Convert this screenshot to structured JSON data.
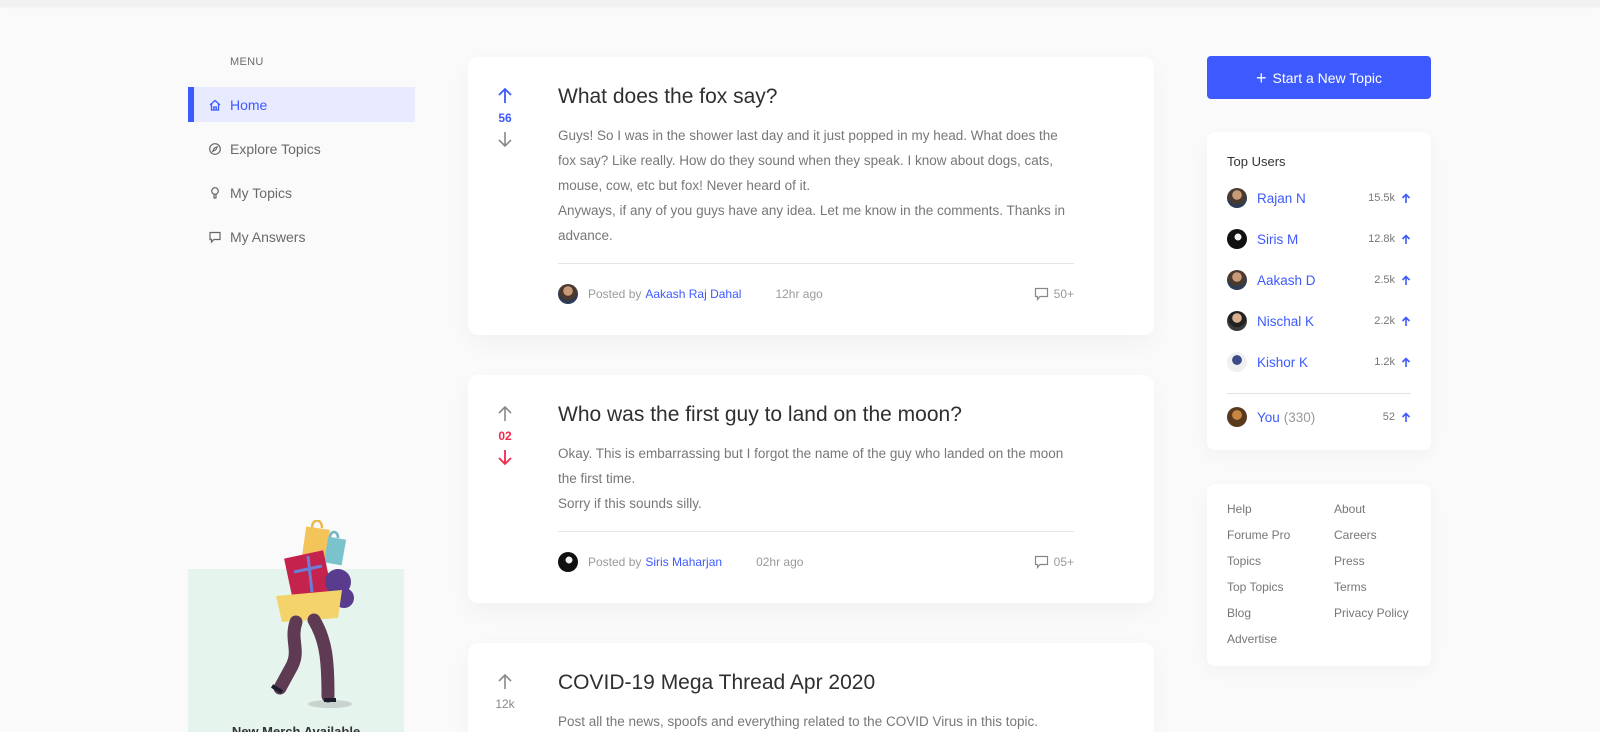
{
  "menu": {
    "title": "MENU",
    "items": [
      {
        "label": "Home",
        "icon": "home-icon",
        "active": true
      },
      {
        "label": "Explore Topics",
        "icon": "compass-icon",
        "active": false
      },
      {
        "label": "My Topics",
        "icon": "bulb-icon",
        "active": false
      },
      {
        "label": "My Answers",
        "icon": "chat-icon",
        "active": false
      }
    ],
    "promo_text": "New Merch Available"
  },
  "posts": [
    {
      "title": "What does the fox say?",
      "votes": "56",
      "vote_state": "up",
      "body": [
        "Guys! So I was in the shower last day and it just popped in my head. What does the fox say? Like really. How do they sound when they speak. I know about dogs, cats, mouse, cow, etc but fox! Never heard of it.",
        "Anyways, if any of you guys have any idea. Let me know in the comments. Thanks in advance."
      ],
      "posted_by_label": "Posted by",
      "author": "Aakash Raj Dahal",
      "time": "12hr ago",
      "comments": "50+"
    },
    {
      "title": "Who was the first guy to land on the moon?",
      "votes": "02",
      "vote_state": "down",
      "body": [
        "Okay. This is embarrassing but I forgot the name of the guy who landed on the moon the first time.",
        "Sorry if this sounds silly."
      ],
      "posted_by_label": "Posted by",
      "author": "Siris Maharjan",
      "time": "02hr ago",
      "comments": "05+"
    },
    {
      "title": "COVID-19 Mega Thread Apr 2020",
      "votes": "12k",
      "vote_state": "none",
      "body": [
        "Post all the news, spoofs and everything related to the COVID Virus in this topic."
      ]
    }
  ],
  "sidebar": {
    "new_topic_label": "Start a New Topic",
    "top_users_title": "Top Users",
    "top_users": [
      {
        "name": "Rajan N",
        "score": "15.5k"
      },
      {
        "name": "Siris M",
        "score": "12.8k"
      },
      {
        "name": "Aakash D",
        "score": "2.5k"
      },
      {
        "name": "Nischal K",
        "score": "2.2k"
      },
      {
        "name": "Kishor K",
        "score": "1.2k"
      }
    ],
    "you": {
      "name": "You",
      "rank": "(330)",
      "score": "52"
    },
    "links_left": [
      "Help",
      "Forume Pro",
      "Topics",
      "Top Topics",
      "Blog",
      "Advertise"
    ],
    "links_right": [
      "About",
      "Careers",
      "Press",
      "Terms",
      "Privacy Policy"
    ]
  },
  "colors": {
    "accent": "#3d5afe",
    "downvote": "#f0294e",
    "promo_bg": "#e6f4ee"
  }
}
